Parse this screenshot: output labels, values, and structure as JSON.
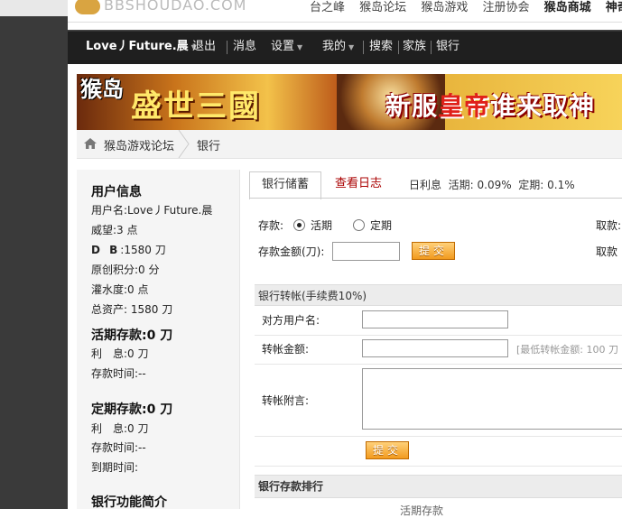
{
  "topstrip": {
    "logo_text": "BBSHOUDAO.COM",
    "links": [
      "台之峰",
      "猴岛论坛",
      "猴岛游戏",
      "注册协会",
      "猴岛商城",
      "神奇猴"
    ]
  },
  "nav": {
    "user": "Love丿Future.晨",
    "logout": "退出",
    "messages": "消息",
    "settings": "设置",
    "mine": "我的",
    "search": "搜索",
    "family": "家族",
    "bank": "银行"
  },
  "banner": {
    "brand": "猴岛",
    "game_title": "盛世三國",
    "slogan_a": "新服",
    "slogan_red": "皇帝",
    "slogan_b": "谁来取",
    "slogan_cut": "神"
  },
  "breadcrumb": {
    "forum": "猴岛游戏论坛",
    "current": "银行"
  },
  "sidebar": {
    "user_info_title": "用户信息",
    "username": "用户名:Love丿Future.晨",
    "prestige": "威望:3 点",
    "db_label": "D B",
    "db_value": ":1580 刀",
    "original_points": "原创积分:0 分",
    "water_level": "灌水度:0 点",
    "total_assets": "总资产: 1580 刀",
    "current_title": "活期存款:0 刀",
    "current_interest": "利　息:0 刀",
    "current_time": "存款时间:--",
    "fixed_title": "定期存款:0 刀",
    "fixed_interest": "利　息:0 刀",
    "fixed_time": "存款时间:--",
    "fixed_expire": "到期时间:",
    "intro_title": "银行功能简介"
  },
  "tabs": {
    "deposit": "银行储蓄",
    "log": "查看日志",
    "daily_rate_label": "日利息",
    "current_rate": "活期: 0.09%",
    "fixed_rate": "定期: 0.1%"
  },
  "deposit": {
    "label": "存款:",
    "opt_current": "活期",
    "opt_fixed": "定期",
    "amount_label": "存款金额(刀):",
    "amount_value": "",
    "submit": "提交",
    "withdraw_label": "取款:",
    "withdraw_amount_label": "取款"
  },
  "transfer": {
    "title": "银行转帐(手续费10%)",
    "target_label": "对方用户名:",
    "target_value": "",
    "amount_label": "转帐金额:",
    "amount_value": "",
    "min_hint": "[最低转帐金额: 100 刀",
    "note_label": "转帐附言:",
    "submit": "提交"
  },
  "ranking": {
    "title": "银行存款排行",
    "col_partial": "活期存款"
  },
  "colors": {
    "accent": "#f29a1e",
    "nav_bg": "#1f1f1f",
    "log_tab": "#aa0000"
  }
}
